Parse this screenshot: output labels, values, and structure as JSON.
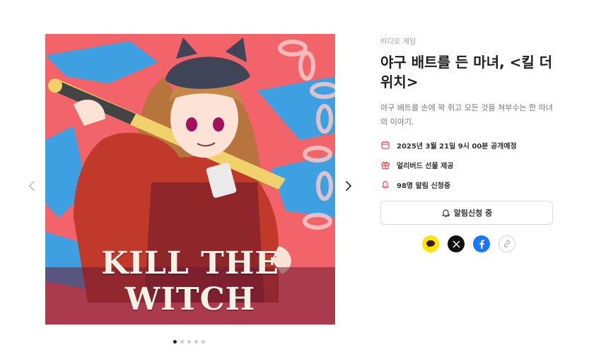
{
  "product": {
    "category": "비디오 게임",
    "title": "야구 배트를 든 마녀, <킬 더 위치>",
    "description": "야구 배트를 손에 꽉 쥐고 모든 것을 쳐부수는 한 마녀의 이야기.",
    "artwork_title": "KILL THE WITCH"
  },
  "meta": [
    {
      "icon": "calendar-icon",
      "text": "2025년 3월 21일 9시 00분 공개예정"
    },
    {
      "icon": "gift-icon",
      "text": "얼리버드 선물 제공"
    },
    {
      "icon": "bell-icon",
      "text": "98명 알림 신청중"
    }
  ],
  "notify_button": {
    "label": "알림신청 중",
    "icon": "bell-check-icon"
  },
  "share": [
    "kakaotalk-icon",
    "x-icon",
    "facebook-icon",
    "link-icon"
  ],
  "carousel": {
    "total": 5,
    "active": 1
  },
  "colors": {
    "accent": "#f24a54",
    "artwork_bg": "#f2646a",
    "artwork_blue": "#3ea0e0"
  }
}
